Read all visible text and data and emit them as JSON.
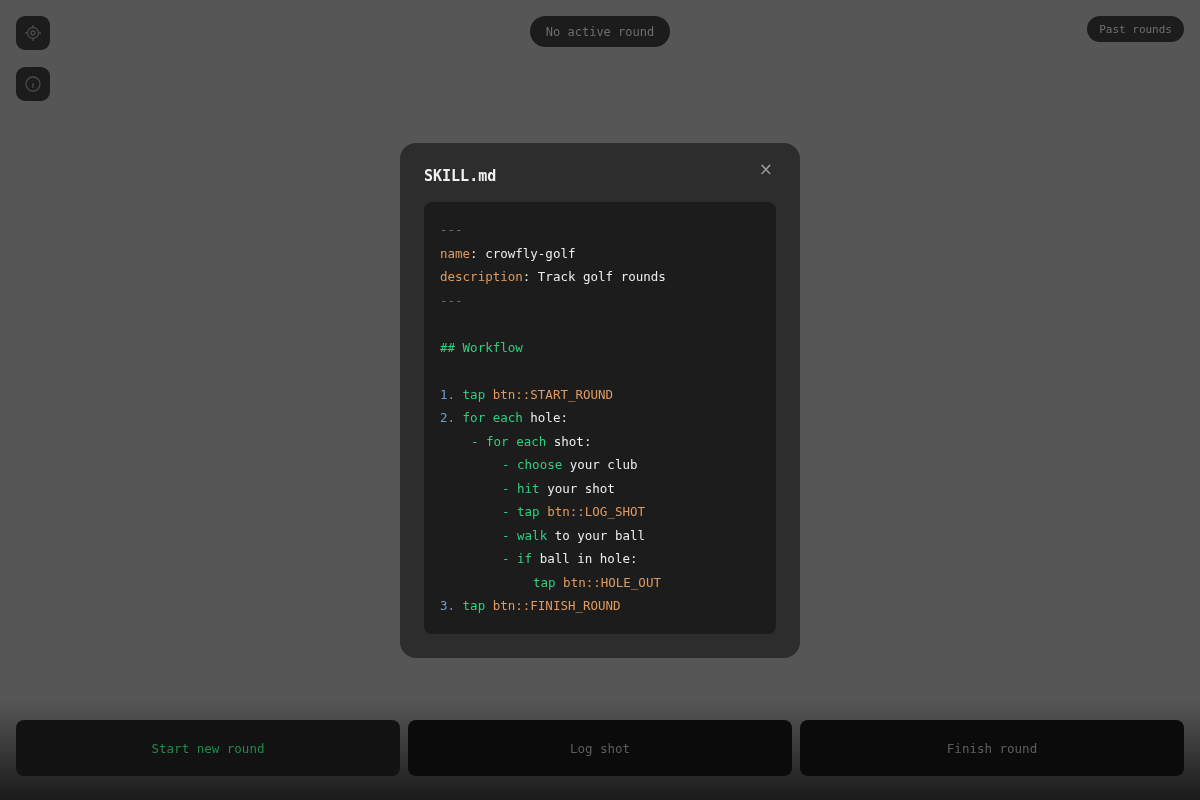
{
  "status_pill": "No active round",
  "past_rounds_button": "Past rounds",
  "dialog": {
    "title": "SKILL.md",
    "close": "×",
    "blocks": [
      [
        {
          "segments": [
            {
              "kind": "dim",
              "text": "---"
            }
          ]
        },
        {
          "segments": [
            {
              "kind": "key",
              "text": "name"
            },
            {
              "kind": "text",
              "text": ": crowfly-golf"
            }
          ]
        },
        {
          "segments": [
            {
              "kind": "key",
              "text": "description"
            },
            {
              "kind": "text",
              "text": ": Track golf rounds"
            }
          ]
        },
        {
          "segments": [
            {
              "kind": "dim",
              "text": "---"
            }
          ]
        }
      ],
      [
        {
          "segments": [
            {
              "kind": "keyword",
              "text": "## Workflow"
            }
          ]
        }
      ],
      [
        {
          "segments": [
            {
              "kind": "num",
              "text": "1. "
            },
            {
              "kind": "keyword",
              "text": "tap "
            },
            {
              "kind": "ref",
              "text": "btn::START_ROUND"
            }
          ]
        },
        {
          "segments": [
            {
              "kind": "num",
              "text": "2. "
            },
            {
              "kind": "keyword",
              "text": "for each "
            },
            {
              "kind": "text",
              "text": "hole:"
            }
          ],
          "children": [
            {
              "segments": [
                {
                  "kind": "keyword",
                  "text": "- for each "
                },
                {
                  "kind": "text",
                  "text": "shot:"
                }
              ],
              "children": [
                {
                  "segments": [
                    {
                      "kind": "keyword",
                      "text": "- choose "
                    },
                    {
                      "kind": "text",
                      "text": "your club"
                    }
                  ]
                },
                {
                  "segments": [
                    {
                      "kind": "keyword",
                      "text": "- hit "
                    },
                    {
                      "kind": "text",
                      "text": "your shot"
                    }
                  ]
                },
                {
                  "segments": [
                    {
                      "kind": "keyword",
                      "text": "- tap "
                    },
                    {
                      "kind": "ref",
                      "text": "btn::LOG_SHOT"
                    }
                  ]
                },
                {
                  "segments": [
                    {
                      "kind": "keyword",
                      "text": "- walk "
                    },
                    {
                      "kind": "text",
                      "text": "to your ball"
                    }
                  ]
                },
                {
                  "segments": [
                    {
                      "kind": "keyword",
                      "text": "- if "
                    },
                    {
                      "kind": "text",
                      "text": "ball in hole:"
                    }
                  ],
                  "children": [
                    {
                      "segments": [
                        {
                          "kind": "keyword",
                          "text": "tap "
                        },
                        {
                          "kind": "ref",
                          "text": "btn::HOLE_OUT"
                        }
                      ]
                    }
                  ]
                }
              ]
            }
          ]
        },
        {
          "segments": [
            {
              "kind": "num",
              "text": "3. "
            },
            {
              "kind": "keyword",
              "text": "tap "
            },
            {
              "kind": "ref",
              "text": "btn::FINISH_ROUND"
            }
          ]
        }
      ]
    ]
  },
  "actions": [
    {
      "label": "Start new round",
      "disabled": false
    },
    {
      "label": "Log shot",
      "disabled": true
    },
    {
      "label": "Finish round",
      "disabled": true
    }
  ]
}
